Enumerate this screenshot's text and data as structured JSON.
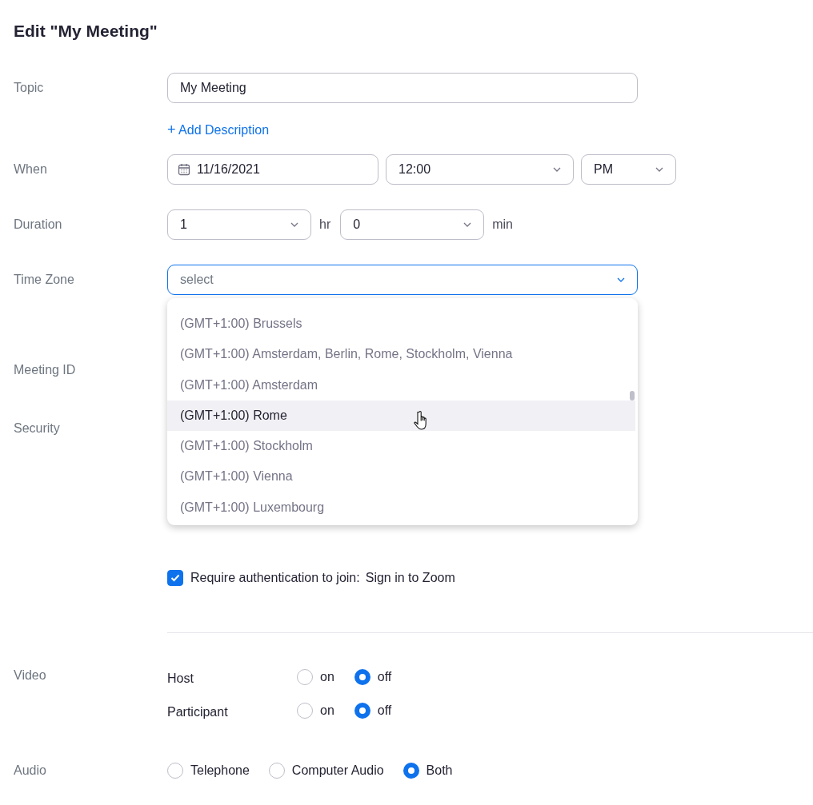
{
  "title": "Edit \"My Meeting\"",
  "topic": {
    "label": "Topic",
    "value": "My Meeting"
  },
  "add_description": {
    "icon": "+",
    "label": "Add Description"
  },
  "when": {
    "label": "When",
    "date": "11/16/2021",
    "time": "12:00",
    "period": "PM"
  },
  "duration": {
    "label": "Duration",
    "hours": "1",
    "hours_unit": "hr",
    "minutes": "0",
    "minutes_unit": "min"
  },
  "time_zone": {
    "label": "Time Zone",
    "placeholder": "select",
    "expanded": true,
    "options": [
      {
        "label": "(GMT+1:00) Brussels",
        "hovered": false
      },
      {
        "label": "(GMT+1:00) Amsterdam, Berlin, Rome, Stockholm, Vienna",
        "hovered": false
      },
      {
        "label": "(GMT+1:00) Amsterdam",
        "hovered": false
      },
      {
        "label": "(GMT+1:00) Rome",
        "hovered": true
      },
      {
        "label": "(GMT+1:00) Stockholm",
        "hovered": false
      },
      {
        "label": "(GMT+1:00) Vienna",
        "hovered": false
      },
      {
        "label": "(GMT+1:00) Luxembourg",
        "hovered": false
      }
    ]
  },
  "meeting_id": {
    "label": "Meeting ID"
  },
  "security": {
    "label": "Security",
    "authentication": {
      "label": "Require authentication to join:",
      "value": "Sign in to Zoom",
      "checked": true
    }
  },
  "video": {
    "label": "Video",
    "rows": [
      {
        "label": "Host",
        "options": [
          {
            "label": "on",
            "selected": false
          },
          {
            "label": "off",
            "selected": true
          }
        ]
      },
      {
        "label": "Participant",
        "options": [
          {
            "label": "on",
            "selected": false
          },
          {
            "label": "off",
            "selected": true
          }
        ]
      }
    ]
  },
  "audio": {
    "label": "Audio",
    "options": [
      {
        "label": "Telephone",
        "selected": false
      },
      {
        "label": "Computer Audio",
        "selected": false
      },
      {
        "label": "Both",
        "selected": true
      }
    ]
  }
}
